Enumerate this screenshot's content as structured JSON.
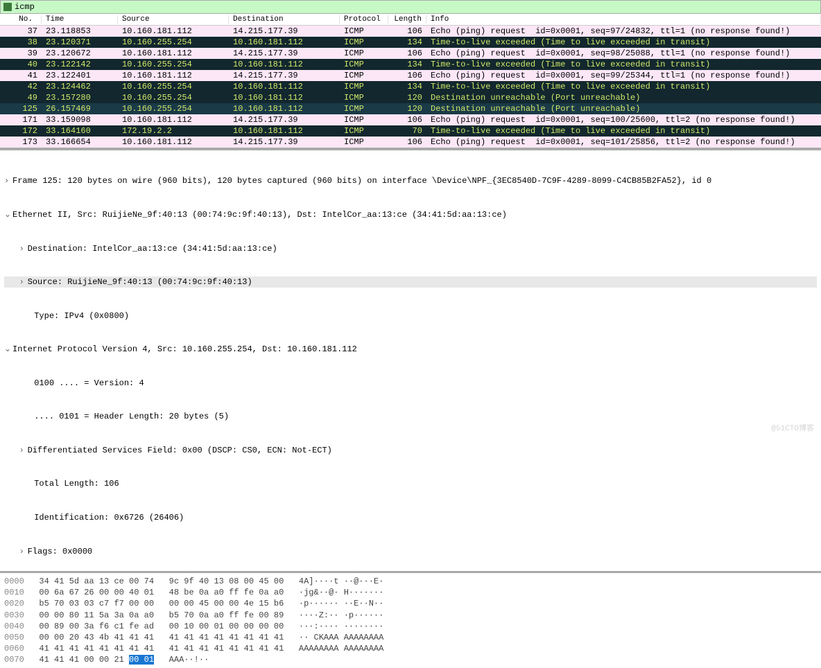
{
  "filter": {
    "value": "icmp"
  },
  "columns": {
    "no": "No.",
    "time": "Time",
    "src": "Source",
    "dst": "Destination",
    "proto": "Protocol",
    "len": "Length",
    "info": "Info"
  },
  "packets": [
    {
      "no": "37",
      "time": "23.118853",
      "src": "10.160.181.112",
      "dst": "14.215.177.39",
      "proto": "ICMP",
      "len": "106",
      "info": "Echo (ping) request  id=0x0001, seq=97/24832, ttl=1 (no response found!)",
      "cls": "pink"
    },
    {
      "no": "38",
      "time": "23.120371",
      "src": "10.160.255.254",
      "dst": "10.160.181.112",
      "proto": "ICMP",
      "len": "134",
      "info": "Time-to-live exceeded (Time to live exceeded in transit)",
      "cls": "dark"
    },
    {
      "no": "39",
      "time": "23.120672",
      "src": "10.160.181.112",
      "dst": "14.215.177.39",
      "proto": "ICMP",
      "len": "106",
      "info": "Echo (ping) request  id=0x0001, seq=98/25088, ttl=1 (no response found!)",
      "cls": "pink"
    },
    {
      "no": "40",
      "time": "23.122142",
      "src": "10.160.255.254",
      "dst": "10.160.181.112",
      "proto": "ICMP",
      "len": "134",
      "info": "Time-to-live exceeded (Time to live exceeded in transit)",
      "cls": "dark"
    },
    {
      "no": "41",
      "time": "23.122401",
      "src": "10.160.181.112",
      "dst": "14.215.177.39",
      "proto": "ICMP",
      "len": "106",
      "info": "Echo (ping) request  id=0x0001, seq=99/25344, ttl=1 (no response found!)",
      "cls": "pink"
    },
    {
      "no": "42",
      "time": "23.124462",
      "src": "10.160.255.254",
      "dst": "10.160.181.112",
      "proto": "ICMP",
      "len": "134",
      "info": "Time-to-live exceeded (Time to live exceeded in transit)",
      "cls": "dark"
    },
    {
      "no": "49",
      "time": "23.157280",
      "src": "10.160.255.254",
      "dst": "10.160.181.112",
      "proto": "ICMP",
      "len": "120",
      "info": "Destination unreachable (Port unreachable)",
      "cls": "dark"
    },
    {
      "no": "125",
      "time": "26.157469",
      "src": "10.160.255.254",
      "dst": "10.160.181.112",
      "proto": "ICMP",
      "len": "120",
      "info": "Destination unreachable (Port unreachable)",
      "cls": "dark sel"
    },
    {
      "no": "171",
      "time": "33.159098",
      "src": "10.160.181.112",
      "dst": "14.215.177.39",
      "proto": "ICMP",
      "len": "106",
      "info": "Echo (ping) request  id=0x0001, seq=100/25600, ttl=2 (no response found!)",
      "cls": "pink"
    },
    {
      "no": "172",
      "time": "33.164160",
      "src": "172.19.2.2",
      "dst": "10.160.181.112",
      "proto": "ICMP",
      "len": "70",
      "info": "Time-to-live exceeded (Time to live exceeded in transit)",
      "cls": "dark"
    },
    {
      "no": "173",
      "time": "33.166654",
      "src": "10.160.181.112",
      "dst": "14.215.177.39",
      "proto": "ICMP",
      "len": "106",
      "info": "Echo (ping) request  id=0x0001, seq=101/25856, ttl=2 (no response found!)",
      "cls": "pink"
    }
  ],
  "details": {
    "frame": "Frame 125: 120 bytes on wire (960 bits), 120 bytes captured (960 bits) on interface \\Device\\NPF_{3EC8540D-7C9F-4289-8099-C4CB85B2FA52}, id 0",
    "eth": "Ethernet II, Src: RuijieNe_9f:40:13 (00:74:9c:9f:40:13), Dst: IntelCor_aa:13:ce (34:41:5d:aa:13:ce)",
    "eth_dst": "Destination: IntelCor_aa:13:ce (34:41:5d:aa:13:ce)",
    "eth_src": "Source: RuijieNe_9f:40:13 (00:74:9c:9f:40:13)",
    "eth_type": "Type: IPv4 (0x0800)",
    "ip": "Internet Protocol Version 4, Src: 10.160.255.254, Dst: 10.160.181.112",
    "ip_ver": "0100 .... = Version: 4",
    "ip_hlen": ".... 0101 = Header Length: 20 bytes (5)",
    "ip_dsf": "Differentiated Services Field: 0x00 (DSCP: CS0, ECN: Not-ECT)",
    "ip_tlen": "Total Length: 106",
    "ip_id": "Identification: 0x6726 (26406)",
    "ip_flags": "Flags: 0x0000"
  },
  "hex": [
    {
      "addr": "0000",
      "b": "34 41 5d aa 13 ce 00 74   9c 9f 40 13 08 00 45 00",
      "a": "4A]····t ··@···E·"
    },
    {
      "addr": "0010",
      "b": "00 6a 67 26 00 00 40 01   48 be 0a a0 ff fe 0a a0",
      "a": "·jg&··@· H·······"
    },
    {
      "addr": "0020",
      "b": "b5 70 03 03 c7 f7 00 00   00 00 45 00 00 4e 15 b6",
      "a": "·p······ ··E··N··"
    },
    {
      "addr": "0030",
      "b": "00 00 80 11 5a 3a 0a a0   b5 70 0a a0 ff fe 00 89",
      "a": "····Z:·· ·p······"
    },
    {
      "addr": "0040",
      "b": "00 89 00 3a f6 c1 fe ad   00 10 00 01 00 00 00 00",
      "a": "···:···· ········"
    },
    {
      "addr": "0050",
      "b": "00 00 20 43 4b 41 41 41   41 41 41 41 41 41 41 41",
      "a": "·· CKAAA AAAAAAAA"
    },
    {
      "addr": "0060",
      "b": "41 41 41 41 41 41 41 41   41 41 41 41 41 41 41 41",
      "a": "AAAAAAAA AAAAAAAA"
    },
    {
      "addr": "0070",
      "b": "41 41 41 00 00 21 ",
      "sel": "00 01",
      "a": "AAA··!·· "
    }
  ],
  "watermark": "@51CTO博客"
}
